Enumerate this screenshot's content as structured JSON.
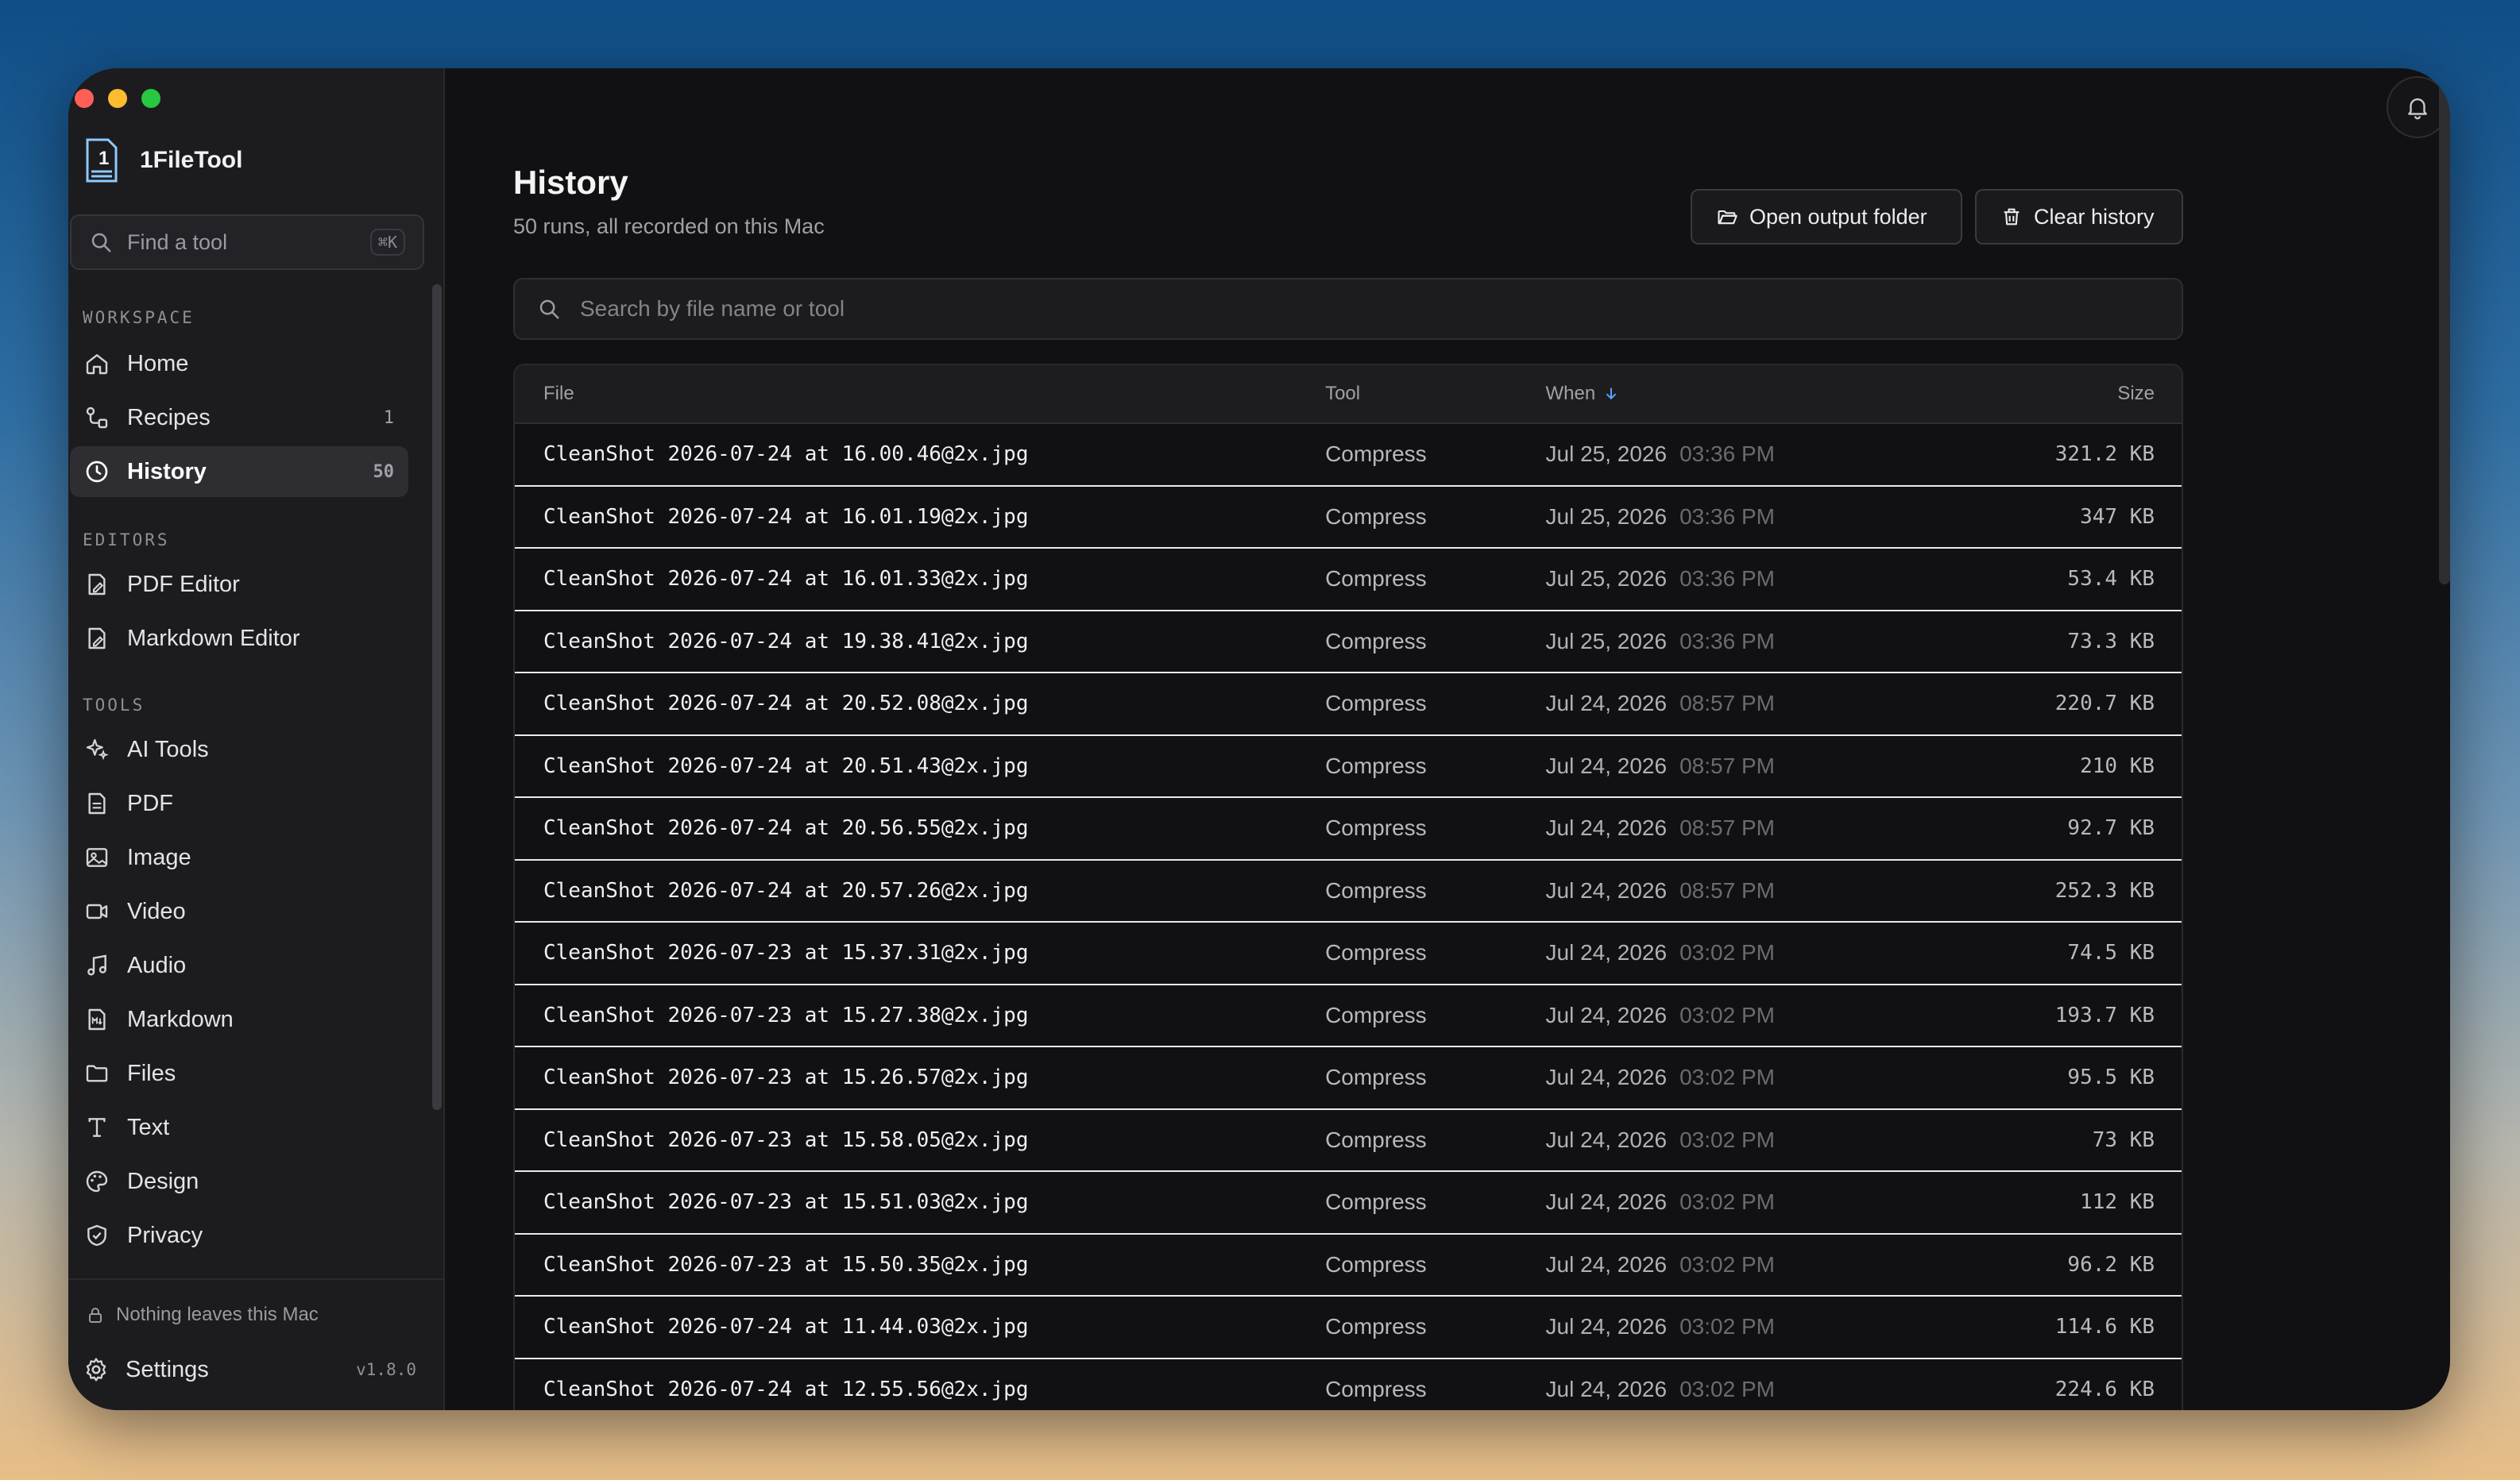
{
  "window": {
    "traffic": [
      "close",
      "minimize",
      "zoom"
    ]
  },
  "brand": {
    "name": "1FileTool",
    "logo_digit": "1"
  },
  "sidebar": {
    "search_placeholder": "Find a tool",
    "search_shortcut": "⌘K",
    "sections": {
      "workspace": "WORKSPACE",
      "editors": "EDITORS",
      "tools": "TOOLS"
    },
    "workspace": [
      {
        "label": "Home",
        "icon": "home-icon",
        "count": ""
      },
      {
        "label": "Recipes",
        "icon": "recipes-icon",
        "count": "1"
      },
      {
        "label": "History",
        "icon": "clock-icon",
        "count": "50",
        "active": true
      }
    ],
    "editors": [
      {
        "label": "PDF Editor",
        "icon": "pdf-edit-icon"
      },
      {
        "label": "Markdown Editor",
        "icon": "markdown-edit-icon"
      }
    ],
    "tools": [
      {
        "label": "AI Tools",
        "icon": "sparkles-icon"
      },
      {
        "label": "PDF",
        "icon": "file-text-icon"
      },
      {
        "label": "Image",
        "icon": "image-icon"
      },
      {
        "label": "Video",
        "icon": "video-icon"
      },
      {
        "label": "Audio",
        "icon": "music-icon"
      },
      {
        "label": "Markdown",
        "icon": "markdown-icon"
      },
      {
        "label": "Files",
        "icon": "folder-icon"
      },
      {
        "label": "Text",
        "icon": "type-icon"
      },
      {
        "label": "Design",
        "icon": "palette-icon"
      },
      {
        "label": "Privacy",
        "icon": "shield-icon"
      }
    ],
    "footer_note": "Nothing leaves this Mac",
    "settings_label": "Settings",
    "version": "v1.8.0"
  },
  "page": {
    "title": "History",
    "subtitle": "50 runs, all recorded on this Mac",
    "open_folder_label": "Open output folder",
    "clear_history_label": "Clear history",
    "search_placeholder": "Search by file name or tool"
  },
  "table": {
    "columns": {
      "file": "File",
      "tool": "Tool",
      "when": "When",
      "size": "Size"
    },
    "rows": [
      {
        "file": "CleanShot 2026-07-24 at 16.00.46@2x.jpg",
        "tool": "Compress",
        "date": "Jul 25, 2026",
        "time": "03:36 PM",
        "size": "321.2 KB"
      },
      {
        "file": "CleanShot 2026-07-24 at 16.01.19@2x.jpg",
        "tool": "Compress",
        "date": "Jul 25, 2026",
        "time": "03:36 PM",
        "size": "347 KB"
      },
      {
        "file": "CleanShot 2026-07-24 at 16.01.33@2x.jpg",
        "tool": "Compress",
        "date": "Jul 25, 2026",
        "time": "03:36 PM",
        "size": "53.4 KB"
      },
      {
        "file": "CleanShot 2026-07-24 at 19.38.41@2x.jpg",
        "tool": "Compress",
        "date": "Jul 25, 2026",
        "time": "03:36 PM",
        "size": "73.3 KB"
      },
      {
        "file": "CleanShot 2026-07-24 at 20.52.08@2x.jpg",
        "tool": "Compress",
        "date": "Jul 24, 2026",
        "time": "08:57 PM",
        "size": "220.7 KB"
      },
      {
        "file": "CleanShot 2026-07-24 at 20.51.43@2x.jpg",
        "tool": "Compress",
        "date": "Jul 24, 2026",
        "time": "08:57 PM",
        "size": "210 KB"
      },
      {
        "file": "CleanShot 2026-07-24 at 20.56.55@2x.jpg",
        "tool": "Compress",
        "date": "Jul 24, 2026",
        "time": "08:57 PM",
        "size": "92.7 KB"
      },
      {
        "file": "CleanShot 2026-07-24 at 20.57.26@2x.jpg",
        "tool": "Compress",
        "date": "Jul 24, 2026",
        "time": "08:57 PM",
        "size": "252.3 KB"
      },
      {
        "file": "CleanShot 2026-07-23 at 15.37.31@2x.jpg",
        "tool": "Compress",
        "date": "Jul 24, 2026",
        "time": "03:02 PM",
        "size": "74.5 KB"
      },
      {
        "file": "CleanShot 2026-07-23 at 15.27.38@2x.jpg",
        "tool": "Compress",
        "date": "Jul 24, 2026",
        "time": "03:02 PM",
        "size": "193.7 KB"
      },
      {
        "file": "CleanShot 2026-07-23 at 15.26.57@2x.jpg",
        "tool": "Compress",
        "date": "Jul 24, 2026",
        "time": "03:02 PM",
        "size": "95.5 KB"
      },
      {
        "file": "CleanShot 2026-07-23 at 15.58.05@2x.jpg",
        "tool": "Compress",
        "date": "Jul 24, 2026",
        "time": "03:02 PM",
        "size": "73 KB"
      },
      {
        "file": "CleanShot 2026-07-23 at 15.51.03@2x.jpg",
        "tool": "Compress",
        "date": "Jul 24, 2026",
        "time": "03:02 PM",
        "size": "112 KB"
      },
      {
        "file": "CleanShot 2026-07-23 at 15.50.35@2x.jpg",
        "tool": "Compress",
        "date": "Jul 24, 2026",
        "time": "03:02 PM",
        "size": "96.2 KB"
      },
      {
        "file": "CleanShot 2026-07-24 at 11.44.03@2x.jpg",
        "tool": "Compress",
        "date": "Jul 24, 2026",
        "time": "03:02 PM",
        "size": "114.6 KB"
      },
      {
        "file": "CleanShot 2026-07-24 at 12.55.56@2x.jpg",
        "tool": "Compress",
        "date": "Jul 24, 2026",
        "time": "03:02 PM",
        "size": "224.6 KB"
      }
    ]
  },
  "colors": {
    "background": "#111113",
    "sidebar": "#1c1c1f",
    "accent_sort": "#5aa2ff"
  }
}
